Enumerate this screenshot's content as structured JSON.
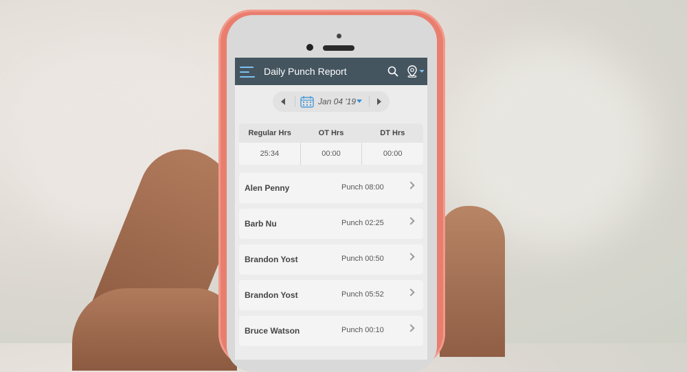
{
  "app": {
    "title": "Daily Punch Report",
    "accent_color": "#7fc3f0",
    "header_color": "#445560"
  },
  "date_nav": {
    "date": "Jan 04 '19"
  },
  "hours": {
    "headers": [
      "Regular Hrs",
      "OT Hrs",
      "DT Hrs"
    ],
    "values": [
      "25:34",
      "00:00",
      "00:00"
    ]
  },
  "employees": [
    {
      "name": "Alen Penny",
      "punch": "Punch 08:00"
    },
    {
      "name": "Barb Nu",
      "punch": "Punch 02:25"
    },
    {
      "name": "Brandon Yost",
      "punch": "Punch 00:50"
    },
    {
      "name": "Brandon Yost",
      "punch": "Punch 05:52"
    },
    {
      "name": "Bruce Watson",
      "punch": "Punch 00:10"
    }
  ]
}
